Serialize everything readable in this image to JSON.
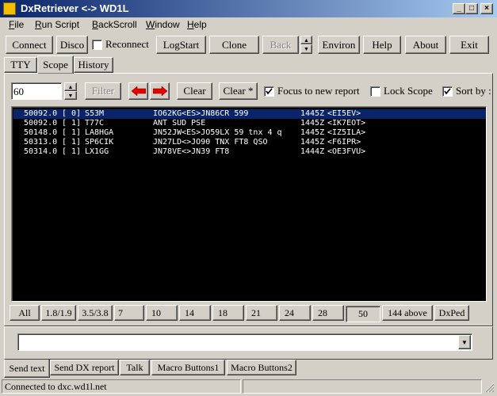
{
  "window": {
    "title": "DxRetriever <-> WD1L",
    "controls": {
      "minimize": "_",
      "maximize": "□",
      "close": "×"
    }
  },
  "menu": [
    "File",
    "Run Script",
    "BackScroll",
    "Window",
    "Help"
  ],
  "toolbar": {
    "connect": "Connect",
    "disco": "Disco",
    "reconnect": "Reconnect",
    "reconnect_checked": false,
    "logstart": "LogStart",
    "clone": "Clone",
    "back": "Back",
    "environ": "Environ",
    "help": "Help",
    "about": "About",
    "exit": "Exit"
  },
  "tabs": [
    "TTY",
    "Scope",
    "History"
  ],
  "active_tab": "Scope",
  "scope": {
    "count_value": "60",
    "filter": "Filter",
    "clear": "Clear",
    "clear_star": "Clear *",
    "focus_label": "Focus to new report",
    "focus_checked": true,
    "lock_label": "Lock Scope",
    "lock_checked": false,
    "sort_label": "Sort by :",
    "sort_checked": true
  },
  "spots": [
    {
      "freq": "50092.0",
      "count": "[ 0]",
      "call": "S53M",
      "comment": "IO62KG<ES>JN86CR 599",
      "time": "1445Z",
      "spotter": "<EI5EV>",
      "selected": true
    },
    {
      "freq": "50092.0",
      "count": "[ 1]",
      "call": "T77C",
      "comment": "ANT SUD PSE",
      "time": "1445Z",
      "spotter": "<IK7EOT>",
      "selected": false
    },
    {
      "freq": "50148.0",
      "count": "[ 1]",
      "call": "LA8HGA",
      "comment": "JN52JW<ES>JO59LX 59 tnx 4 q",
      "time": "1445Z",
      "spotter": "<IZ5ILA>",
      "selected": false
    },
    {
      "freq": "50313.0",
      "count": "[ 1]",
      "call": "SP6CIK",
      "comment": "JN27LD<>JO90 TNX FT8 QSO",
      "time": "1445Z",
      "spotter": "<F6IPR>",
      "selected": false
    },
    {
      "freq": "50314.0",
      "count": "[ 1]",
      "call": "LX1GG",
      "comment": "JN78VE<>JN39 FT8",
      "time": "1444Z",
      "spotter": "<OE3FVU>",
      "selected": false
    }
  ],
  "bands": [
    "All",
    "1.8/1.9",
    "3.5/3.8",
    "7",
    "10",
    "14",
    "18",
    "21",
    "24",
    "28",
    "50",
    "144 above",
    "DxPed"
  ],
  "active_band": "50",
  "send": {
    "input_value": ""
  },
  "bottom_tabs": [
    "Send text",
    "Send DX report",
    "Talk",
    "Macro Buttons1",
    "Macro Buttons2"
  ],
  "active_bottom_tab": "Send text",
  "status": {
    "text": "Connected to dxc.wd1l.net"
  }
}
